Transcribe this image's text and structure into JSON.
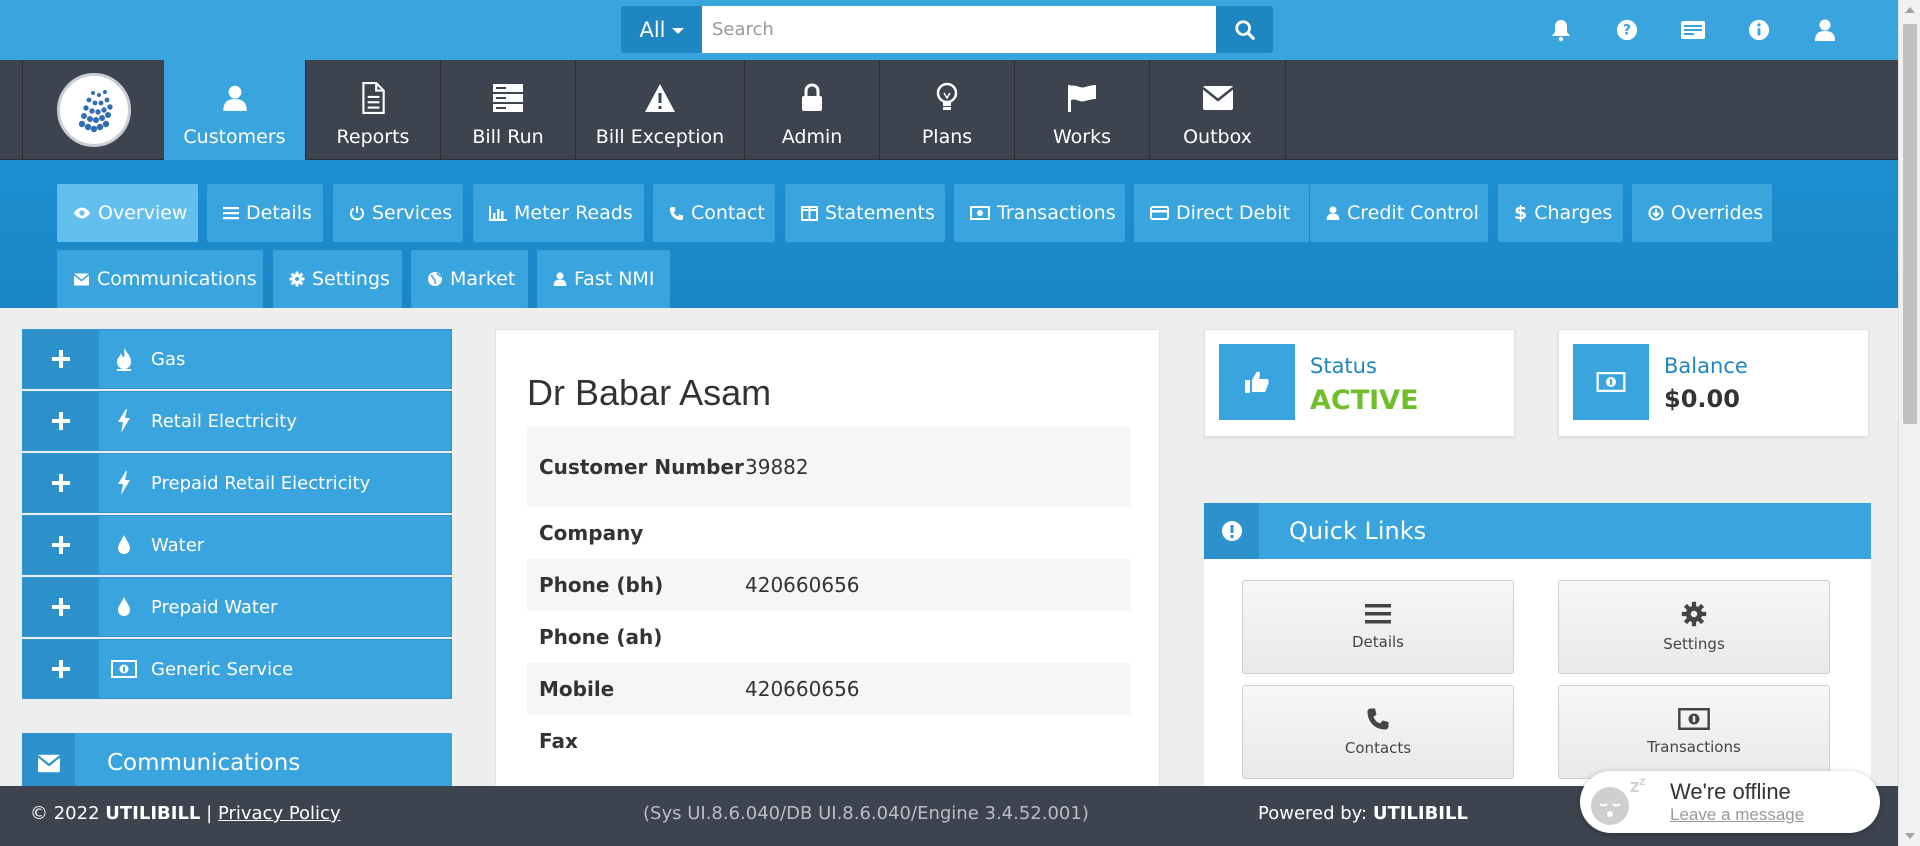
{
  "search": {
    "scope": "All",
    "placeholder": "Search",
    "value": ""
  },
  "top_icons": [
    "bell-icon",
    "help-icon",
    "card-icon",
    "info-icon",
    "user-icon"
  ],
  "main_nav": [
    {
      "label": "Customers",
      "icon": "user-icon",
      "active": true
    },
    {
      "label": "Reports",
      "icon": "file-icon",
      "active": false
    },
    {
      "label": "Bill Run",
      "icon": "server-icon",
      "active": false
    },
    {
      "label": "Bill Exception",
      "icon": "warning-icon",
      "active": false
    },
    {
      "label": "Admin",
      "icon": "lock-icon",
      "active": false
    },
    {
      "label": "Plans",
      "icon": "lightbulb-icon",
      "active": false
    },
    {
      "label": "Works",
      "icon": "flag-icon",
      "active": false
    },
    {
      "label": "Outbox",
      "icon": "envelope-icon",
      "active": false
    }
  ],
  "sub_nav": [
    {
      "label": "Overview",
      "icon": "eye-icon",
      "active": true
    },
    {
      "label": "Details",
      "icon": "list-icon",
      "active": false
    },
    {
      "label": "Services",
      "icon": "power-icon",
      "active": false
    },
    {
      "label": "Meter Reads",
      "icon": "bar-chart-icon",
      "active": false
    },
    {
      "label": "Contact",
      "icon": "phone-icon",
      "active": false
    },
    {
      "label": "Statements",
      "icon": "columns-icon",
      "active": false
    },
    {
      "label": "Transactions",
      "icon": "money-icon",
      "active": false
    },
    {
      "label": "Direct Debit",
      "icon": "credit-card-icon",
      "active": false
    },
    {
      "label": "Credit Control",
      "icon": "user-icon",
      "active": false
    },
    {
      "label": "Charges",
      "icon": "dollar-icon",
      "active": false
    },
    {
      "label": "Overrides",
      "icon": "arrow-circle-icon",
      "active": false
    },
    {
      "label": "Communications",
      "icon": "envelope-icon",
      "active": false
    },
    {
      "label": "Settings",
      "icon": "gear-icon",
      "active": false
    },
    {
      "label": "Market",
      "icon": "globe-icon",
      "active": false
    },
    {
      "label": "Fast NMI",
      "icon": "user-icon",
      "active": false
    }
  ],
  "services": [
    {
      "label": "Gas",
      "icon": "fire-icon"
    },
    {
      "label": "Retail Electricity",
      "icon": "bolt-icon"
    },
    {
      "label": "Prepaid Retail Electricity",
      "icon": "bolt-icon"
    },
    {
      "label": "Water",
      "icon": "drop-icon"
    },
    {
      "label": "Prepaid Water",
      "icon": "drop-icon"
    },
    {
      "label": "Generic Service",
      "icon": "money-icon"
    }
  ],
  "communications": {
    "label": "Communications"
  },
  "customer": {
    "name": "Dr Babar Asam",
    "fields": [
      {
        "key": "Customer Number",
        "value": "39882"
      },
      {
        "key": "Company",
        "value": ""
      },
      {
        "key": "Phone (bh)",
        "value": "420660656"
      },
      {
        "key": "Phone (ah)",
        "value": ""
      },
      {
        "key": "Mobile",
        "value": "420660656"
      },
      {
        "key": "Fax",
        "value": ""
      }
    ]
  },
  "status": {
    "label": "Status",
    "value": "ACTIVE",
    "color": "#6fbf2a"
  },
  "balance": {
    "label": "Balance",
    "value": "$0.00"
  },
  "quick_links": {
    "title": "Quick Links",
    "items": [
      {
        "label": "Details",
        "icon": "list-icon"
      },
      {
        "label": "Settings",
        "icon": "gear-icon"
      },
      {
        "label": "Contacts",
        "icon": "phone-icon"
      },
      {
        "label": "Transactions",
        "icon": "money-icon"
      }
    ]
  },
  "footer": {
    "copyright": "© 2022",
    "brand": "UTILIBILL",
    "separator": "|",
    "privacy": "Privacy Policy",
    "version": "(Sys UI.8.6.040/DB UI.8.6.040/Engine 3.4.52.001)",
    "powered_label": "Powered by:",
    "powered_brand": "UTILIBILL"
  },
  "chat": {
    "title": "We're offline",
    "link": "Leave a message"
  },
  "colors": {
    "primary": "#3aa4de",
    "dark": "#3d434f",
    "status_active": "#6fbf2a"
  }
}
